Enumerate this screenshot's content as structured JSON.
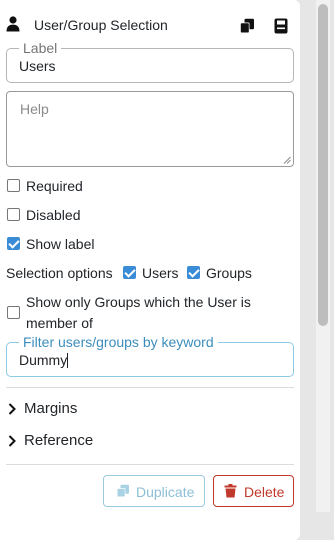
{
  "header": {
    "title": "User/Group Selection",
    "icons": [
      "user-icon",
      "copy-icon",
      "save-icon"
    ]
  },
  "label_field": {
    "legend": "Label",
    "value": "Users"
  },
  "help_field": {
    "placeholder": "Help",
    "value": ""
  },
  "options": {
    "required": {
      "label": "Required",
      "checked": false
    },
    "disabled": {
      "label": "Disabled",
      "checked": false
    },
    "show_label": {
      "label": "Show label",
      "checked": true
    }
  },
  "selection_options": {
    "label": "Selection options",
    "users": {
      "label": "Users",
      "checked": true
    },
    "groups": {
      "label": "Groups",
      "checked": true
    }
  },
  "groups_member": {
    "label_line1": "Show only Groups which the User is",
    "label_line2": "member of",
    "checked": false
  },
  "filter_field": {
    "legend": "Filter users/groups by keyword",
    "value": "Dummy"
  },
  "sections": {
    "margins": "Margins",
    "reference": "Reference"
  },
  "buttons": {
    "duplicate": "Duplicate",
    "delete": "Delete"
  },
  "colors": {
    "accent": "#3b8cd6",
    "danger": "#c0392b",
    "focus_border": "#8ec9e6",
    "disabled_button": "#8cbfd6"
  }
}
